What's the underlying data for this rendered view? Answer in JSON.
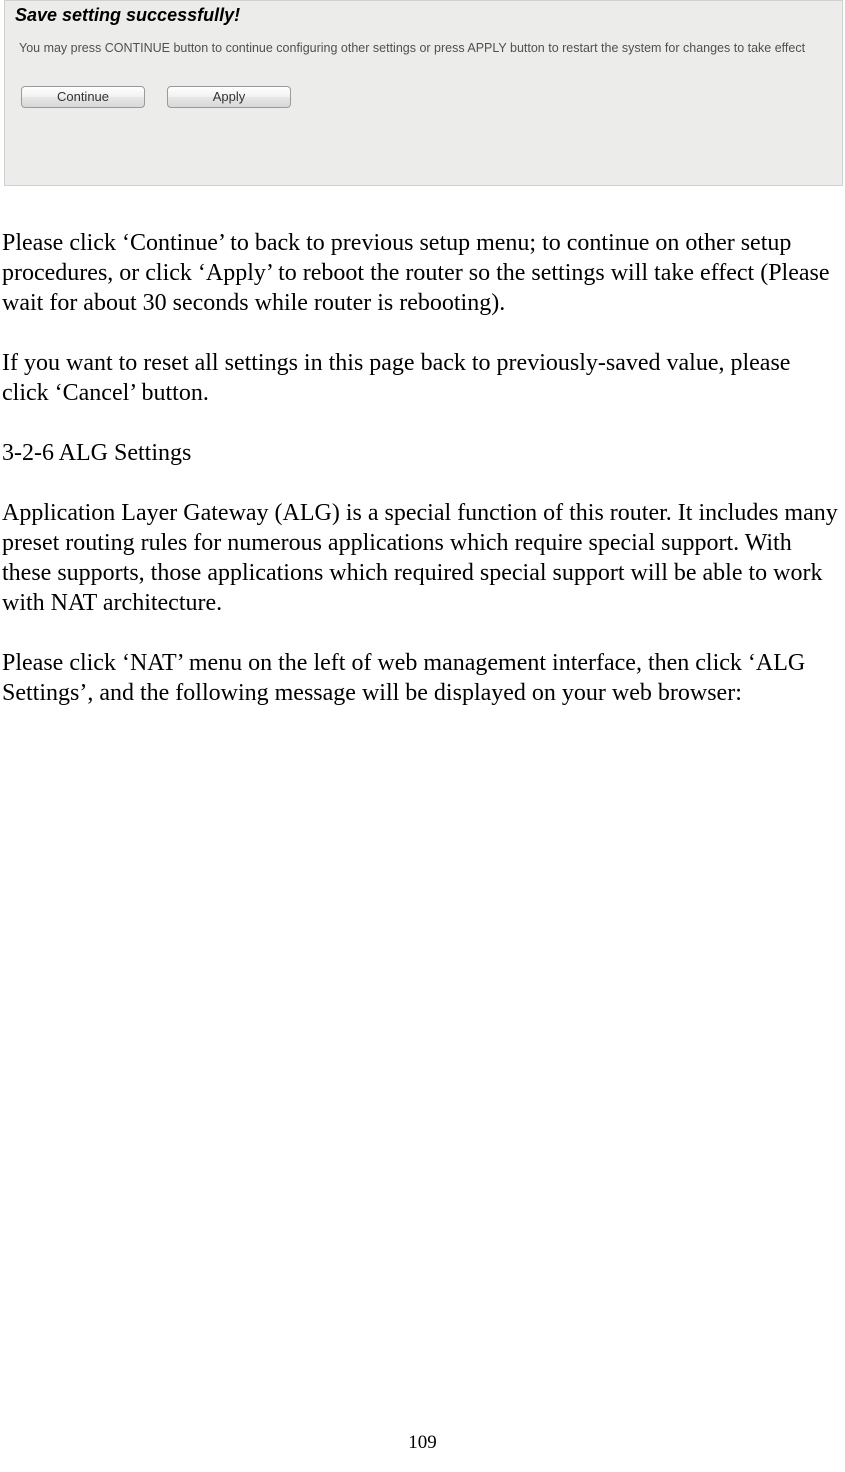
{
  "dialog": {
    "title": "Save setting successfully!",
    "message": "You may press CONTINUE button to continue configuring other settings or press APPLY button to restart the system for changes to take effect",
    "continue_label": "Continue",
    "apply_label": "Apply"
  },
  "doc": {
    "para1": "Please click ‘Continue’ to back to previous setup menu; to continue on other setup procedures, or click ‘Apply’ to reboot the router so the settings will take effect (Please wait for about 30 seconds while router is rebooting).",
    "para2": "If you want to reset all settings in this page back to previously-saved value, please click ‘Cancel’ button.",
    "section_heading": "3-2-6 ALG Settings",
    "para3": "Application Layer Gateway (ALG) is a special function of this router. It includes many preset routing rules for numerous applications which require special support. With these supports, those applications which required special support will be able to work with NAT architecture.",
    "para4": "Please click ‘NAT’ menu on the left of web management interface, then click ‘ALG Settings’, and the following message will be displayed on your web browser:"
  },
  "page_number": "109"
}
